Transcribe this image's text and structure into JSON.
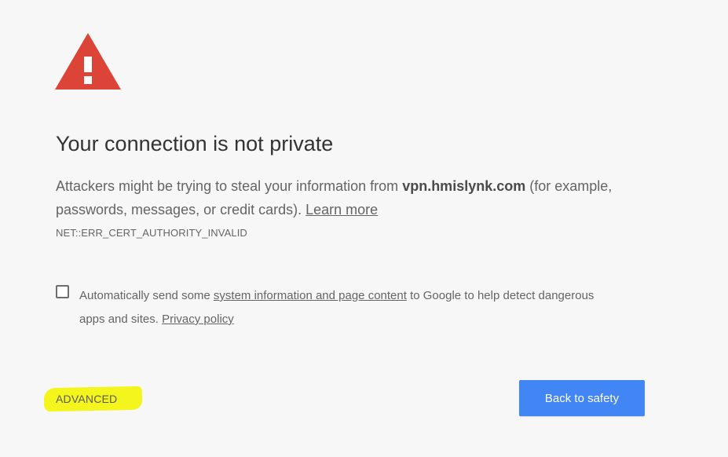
{
  "page": {
    "title": "Your connection is not private",
    "message_prefix": "Attackers might be trying to steal your information from ",
    "domain": "vpn.hmislynk.com",
    "message_suffix": " (for example, passwords, messages, or credit cards). ",
    "learn_more": "Learn more",
    "error_code": "NET::ERR_CERT_AUTHORITY_INVALID"
  },
  "opt_in": {
    "checked": false,
    "text_prefix": "Automatically send some ",
    "link_system_info": "system information and page content",
    "text_middle": " to Google to help detect dangerous apps and sites. ",
    "link_privacy": "Privacy policy"
  },
  "actions": {
    "advanced_label": "ADVANCED",
    "back_label": "Back to safety"
  },
  "colors": {
    "warning_red": "#db4437",
    "primary_blue": "#4285f4",
    "highlight_yellow": "#f5f51e",
    "background": "#f7f7f7"
  },
  "icons": {
    "warning": "warning-triangle-icon"
  }
}
